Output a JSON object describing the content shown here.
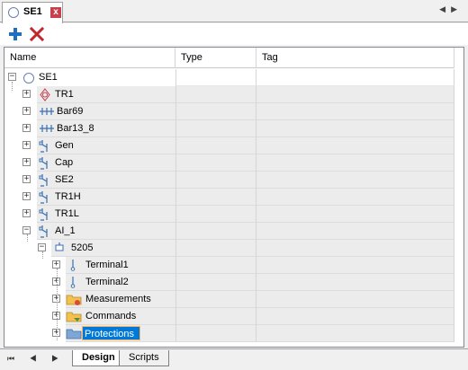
{
  "document_tab": {
    "title": "SE1",
    "close_glyph": "x"
  },
  "tab_nav": {
    "prev": "◀",
    "next": "▶"
  },
  "toolbar": {
    "add_icon": "plus-icon",
    "delete_icon": "x-icon"
  },
  "grid": {
    "columns": [
      "Name",
      "Type",
      "Tag"
    ],
    "rows": [
      {
        "label": "SE1",
        "icon": "substation-icon",
        "expander": "−"
      },
      {
        "label": "TR1",
        "icon": "transformer-icon",
        "expander": "+"
      },
      {
        "label": "Bar69",
        "icon": "busbar-icon",
        "expander": "+"
      },
      {
        "label": "Bar13_8",
        "icon": "busbar-icon",
        "expander": "+"
      },
      {
        "label": "Gen",
        "icon": "bay-icon",
        "expander": "+"
      },
      {
        "label": "Cap",
        "icon": "bay-icon",
        "expander": "+"
      },
      {
        "label": "SE2",
        "icon": "bay-icon",
        "expander": "+"
      },
      {
        "label": "TR1H",
        "icon": "bay-icon",
        "expander": "+"
      },
      {
        "label": "TR1L",
        "icon": "bay-icon",
        "expander": "+"
      },
      {
        "label": "AI_1",
        "icon": "bay-icon",
        "expander": "−"
      },
      {
        "label": "5205",
        "icon": "device-icon",
        "expander": "−"
      },
      {
        "label": "Terminal1",
        "icon": "terminal-icon",
        "expander": "+"
      },
      {
        "label": "Terminal2",
        "icon": "terminal-icon",
        "expander": "+"
      },
      {
        "label": "Measurements",
        "icon": "folder-icon",
        "expander": "+"
      },
      {
        "label": "Commands",
        "icon": "folder-icon",
        "expander": "+"
      },
      {
        "label": "Protections",
        "icon": "folder-icon",
        "expander": "+"
      }
    ]
  },
  "bottom": {
    "pager": "⏮ ◀ ▶ ⏭",
    "tabs": [
      "Design",
      "Scripts"
    ]
  }
}
